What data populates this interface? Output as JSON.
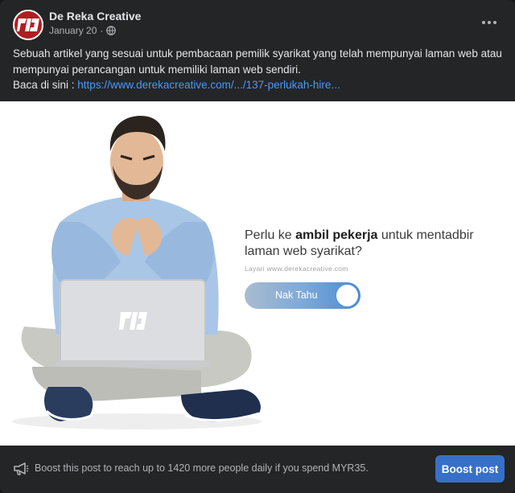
{
  "post": {
    "page_name": "De Reka Creative",
    "date": "January 20",
    "separator": "·",
    "avatar_text": "RKA",
    "text": "Sebuah artikel yang sesuai untuk pembacaan pemilik syarikat yang telah mempunyai laman web atau mempunyai perancangan untuk memiliki laman web sendiri.",
    "read_prefix": "Baca di sini : ",
    "link": "https://www.derekacreative.com/.../137-perlukah-hire..."
  },
  "image": {
    "headline_pre": "Perlu ke ",
    "headline_bold": "ambil pekerja",
    "headline_post": " untuk mentadbir laman web syarikat?",
    "subtext": "Layari www.derekacreative.com",
    "toggle_label": "Nak Tahu",
    "laptop_logo": "RKA"
  },
  "footer": {
    "boost_text": "Boost this post to reach up to 1420 more people daily if you spend MYR35.",
    "boost_button": "Boost post"
  },
  "colors": {
    "background": "#242526",
    "link": "#4599ff",
    "boost_button": "#3770c8",
    "avatar": "#b01e23"
  },
  "icons": [
    "globe-icon",
    "more-options-icon",
    "megaphone-icon"
  ]
}
